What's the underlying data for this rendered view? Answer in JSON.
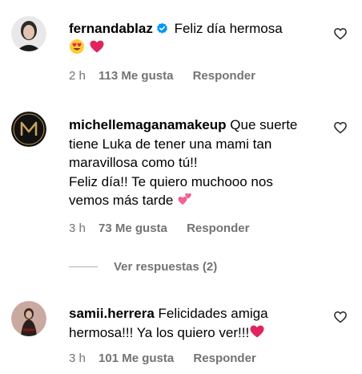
{
  "comments": [
    {
      "username": "fernandablaz",
      "verified": true,
      "text_lines": [
        "Feliz día hermosa"
      ],
      "emojis": [
        "heart-eyes-emoji",
        "red-heart-emoji"
      ],
      "time": "2 h",
      "likes": "113 Me gusta",
      "reply": "Responder"
    },
    {
      "username": "michellemaganamakeup",
      "text_lines": [
        "Que suerte",
        "tiene Luka de tener una mami tan",
        "maravillosa como tú!!",
        "Feliz día!! Te quiero muchooo nos",
        "vemos más tarde"
      ],
      "emojis": [
        "two-hearts-emoji"
      ],
      "time": "3 h",
      "likes": "73 Me gusta",
      "reply": "Responder",
      "view_replies": "Ver respuestas (2)"
    },
    {
      "username": "samii.herrera",
      "text_lines": [
        "Felicidades amiga",
        "hermosa!!! Ya los quiero ver!!!"
      ],
      "emojis": [
        "red-heart-emoji"
      ],
      "time": "3 h",
      "likes": "101 Me gusta",
      "reply": "Responder"
    }
  ],
  "colors": {
    "text": "#000000",
    "secondary": "#737373",
    "verified_blue": "#0095f6",
    "heart_red": "#e0245e"
  }
}
